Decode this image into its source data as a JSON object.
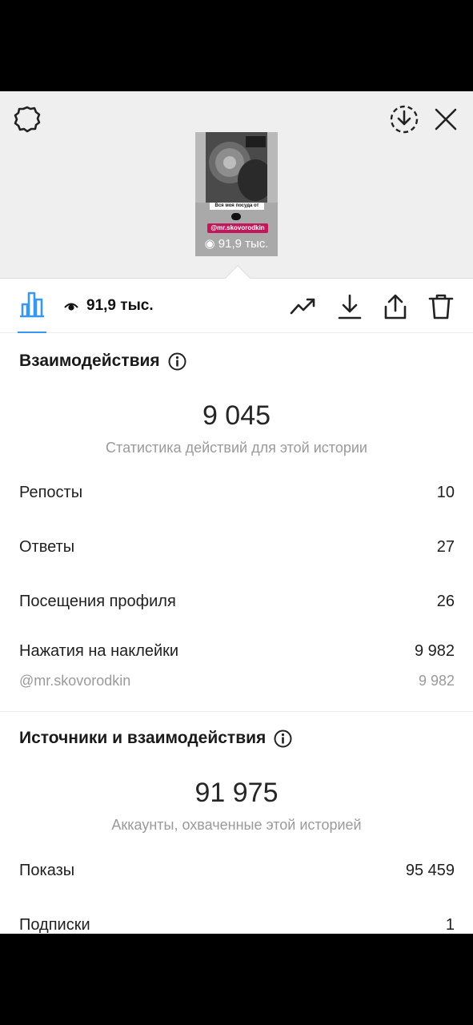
{
  "story": {
    "caption": "Вся моя посуда от",
    "tag": "@mr.skovorodkin",
    "views": "91,9 тыс."
  },
  "toolbar": {
    "views": "91,9 тыс."
  },
  "interactions": {
    "title": "Взаимодействия",
    "total": "9 045",
    "subtitle": "Статистика действий для этой истории",
    "rows": [
      {
        "label": "Репосты",
        "value": "10"
      },
      {
        "label": "Ответы",
        "value": "27"
      },
      {
        "label": "Посещения профиля",
        "value": "26"
      },
      {
        "label": "Нажатия на наклейки",
        "value": "9 982"
      }
    ],
    "sticker": {
      "label": "@mr.skovorodkin",
      "value": "9 982"
    }
  },
  "discovery": {
    "title": "Источники и взаимодействия",
    "total": "91 975",
    "subtitle": "Аккаунты, охваченные этой историей",
    "rows": [
      {
        "label": "Показы",
        "value": "95 459"
      },
      {
        "label": "Подписки",
        "value": "1"
      }
    ]
  },
  "colors": {
    "accent": "#3897f0",
    "tag_bg": "#c2185b"
  }
}
